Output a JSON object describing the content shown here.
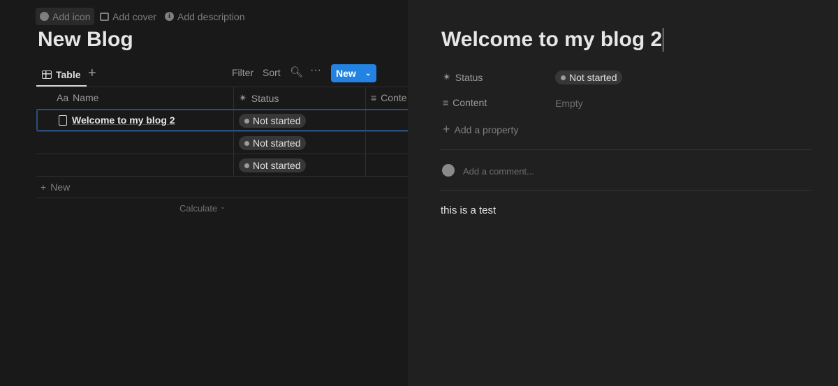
{
  "page_actions": {
    "add_icon": "Add icon",
    "add_cover": "Add cover",
    "add_description": "Add description"
  },
  "database": {
    "title": "New Blog",
    "view_tab": "Table",
    "toolbar": {
      "filter": "Filter",
      "sort": "Sort",
      "new": "New"
    },
    "columns": [
      "Name",
      "Status",
      "Conte"
    ],
    "name_col_prefix": "Aa",
    "rows": [
      {
        "name": "Welcome to my blog 2",
        "status": "Not started"
      },
      {
        "name": "",
        "status": "Not started"
      },
      {
        "name": "",
        "status": "Not started"
      }
    ],
    "add_row": "New",
    "calculate": "Calculate"
  },
  "peek": {
    "title": "Welcome to my blog 2",
    "properties": [
      {
        "label": "Status",
        "value": "Not started"
      },
      {
        "label": "Content",
        "value": "Empty"
      }
    ],
    "add_property": "Add a property",
    "comment_placeholder": "Add a comment...",
    "body": "this is a test"
  },
  "colors": {
    "accent": "#2383e2",
    "bg_left": "#191919",
    "bg_right": "#202020"
  }
}
